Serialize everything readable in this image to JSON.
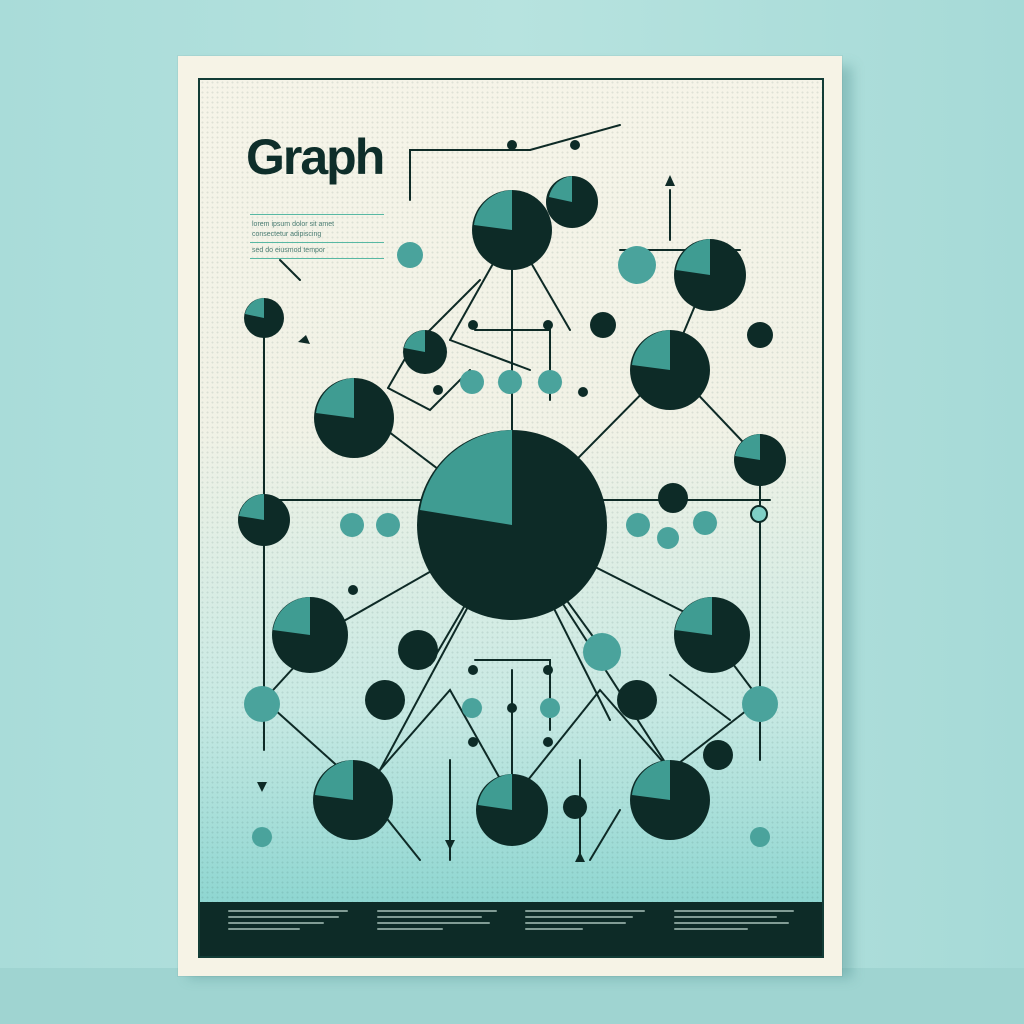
{
  "poster": {
    "title": "Graph",
    "blurb_line_1": "lorem ipsum dolor sit amet",
    "blurb_line_2": "consectetur adipiscing",
    "blurb_line_3": "sed do eiusmod tempor"
  },
  "colors": {
    "dark_node": "#0d2b27",
    "teal_node": "#3f9c92",
    "light_teal": "#5fb8b0",
    "edge": "#0e2a26",
    "paper": "#f6f3e6"
  },
  "footer": {
    "columns": 4
  }
}
